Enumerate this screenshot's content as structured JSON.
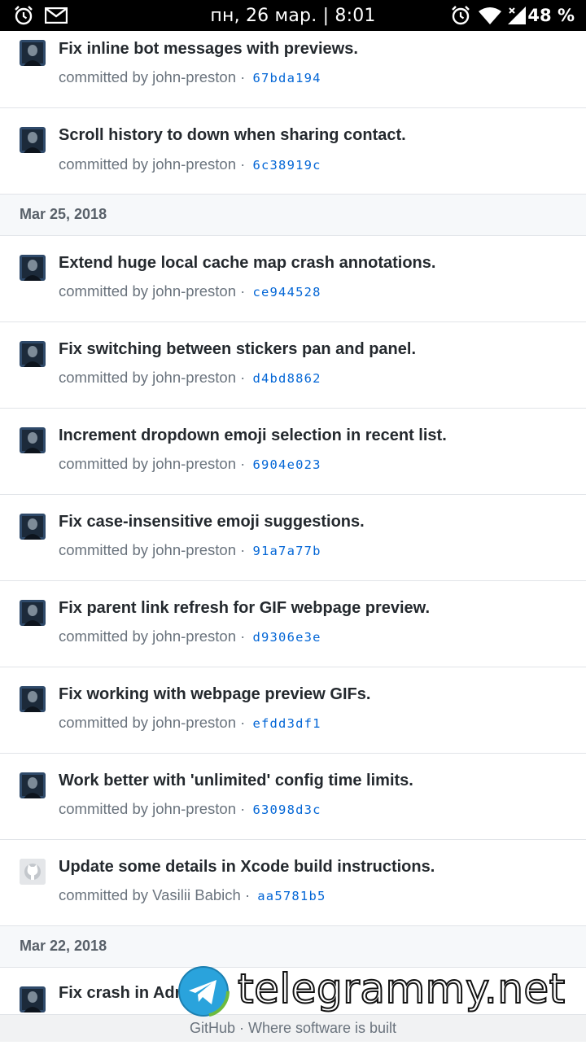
{
  "status_bar": {
    "time": "пн, 26 мар. | 8:01",
    "battery": "48 %",
    "icons": [
      "alarm-icon",
      "mail-icon",
      "alarm-icon",
      "wifi-icon",
      "cellular-icon"
    ]
  },
  "feed": {
    "commit_top": {
      "title": "Fix inline bot messages with previews.",
      "meta": "committed by john-preston ·",
      "sha": "67bda194"
    },
    "commit_2": {
      "title": "Scroll history to down when sharing contact.",
      "meta": "committed by john-preston ·",
      "sha": "6c38919c"
    },
    "date_1": "Mar 25, 2018",
    "group_1": [
      {
        "title": "Extend huge local cache map crash annotations.",
        "meta": "committed by john-preston ·",
        "sha": "ce944528"
      },
      {
        "title": "Fix switching between stickers pan and panel.",
        "meta": "committed by john-preston ·",
        "sha": "d4bd8862"
      },
      {
        "title": "Increment dropdown emoji selection in recent list.",
        "meta": "committed by john-preston ·",
        "sha": "6904e023"
      },
      {
        "title": "Fix case-insensitive emoji suggestions.",
        "meta": "committed by john-preston ·",
        "sha": "91a7a77b"
      },
      {
        "title": "Fix parent link refresh for GIF webpage preview.",
        "meta": "committed by john-preston ·",
        "sha": "d9306e3e"
      },
      {
        "title": "Fix working with webpage preview GIFs.",
        "meta": "committed by john-preston ·",
        "sha": "efdd3df1"
      },
      {
        "title": "Work better with 'unlimited' config time limits.",
        "meta": "committed by john-preston ·",
        "sha": "63098d3c"
      },
      {
        "title": "Update some details in Xcode build instructions.",
        "meta": "committed by Vasilii Babich ·",
        "sha": "aa5781b5"
      }
    ],
    "date_2": "Mar 22, 2018",
    "commit_last": {
      "title": "Fix crash in Admin view with limited admins.",
      "visible_title": "Fix crash in Adm"
    }
  },
  "footer": {
    "text": "GitHub · Where software is built"
  },
  "watermark": {
    "text": "telegrammy.net"
  },
  "colors": {
    "link": "#0366d6",
    "meta": "#6a737d",
    "title": "#24292e",
    "date_bg": "#f6f8fa",
    "border": "#e1e4e8"
  }
}
